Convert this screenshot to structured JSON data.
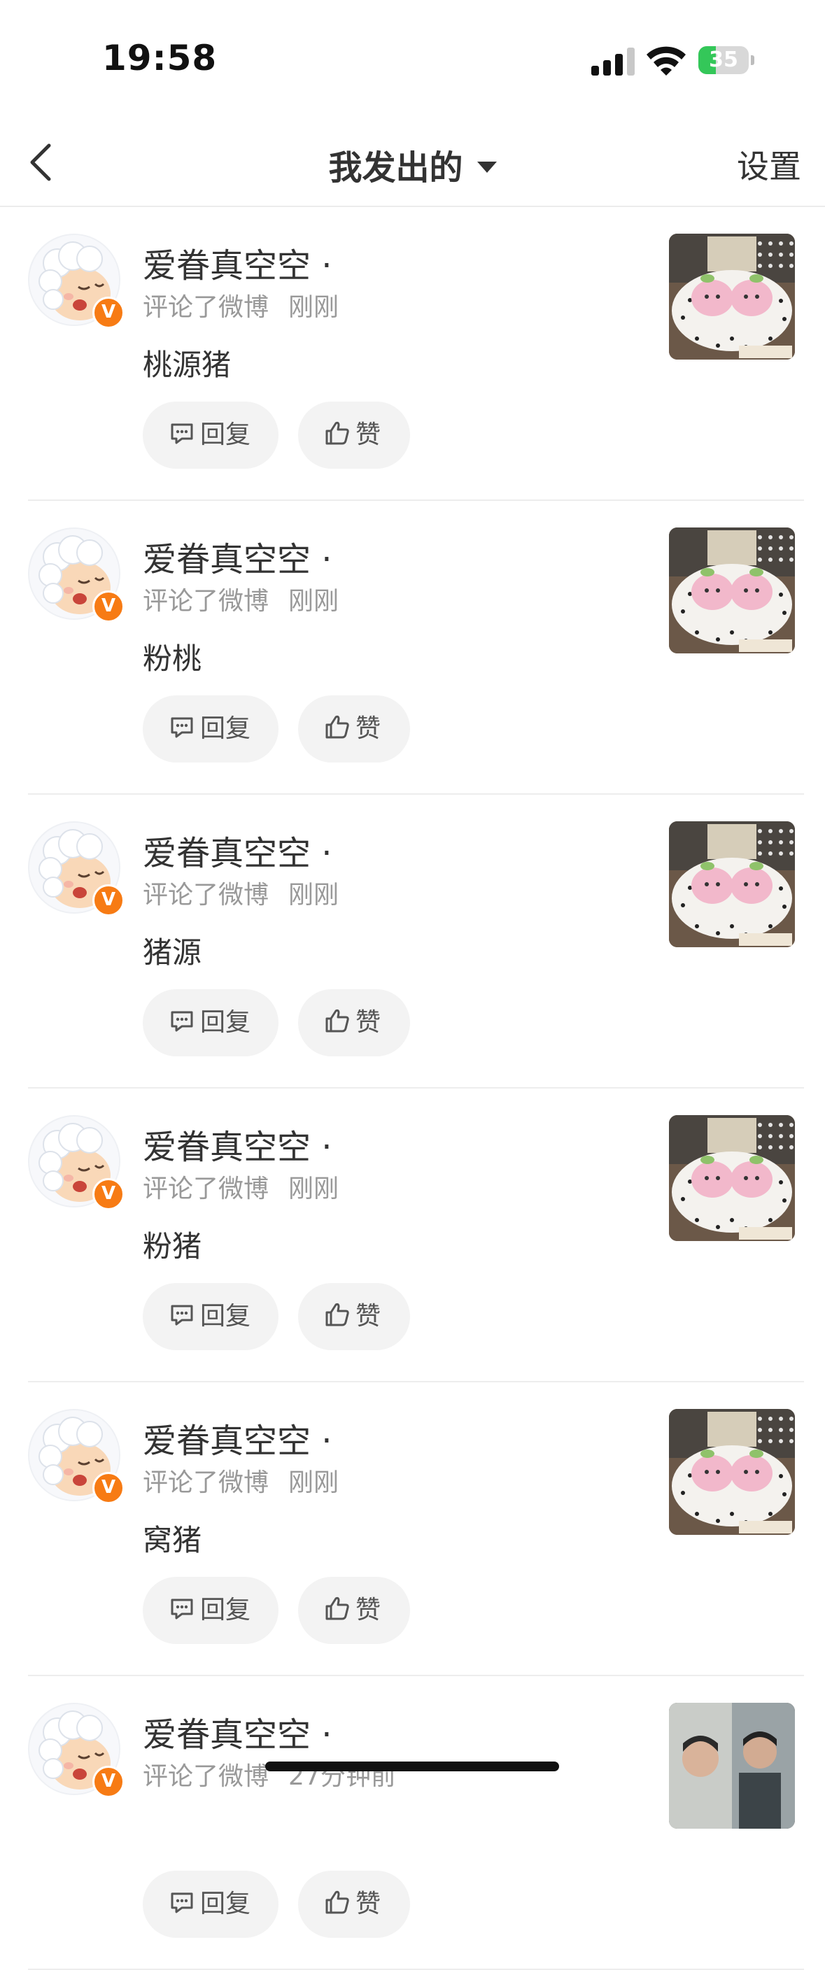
{
  "status_bar": {
    "time": "19:58",
    "battery_level": "35",
    "battery_fraction": 0.35,
    "icons": [
      "signal-icon",
      "wifi-icon",
      "battery-icon",
      "charging-bolt-icon"
    ]
  },
  "nav": {
    "back_icon": "chevron-left-icon",
    "title": "我发出的",
    "title_icon": "caret-down-icon",
    "settings_label": "设置"
  },
  "colors": {
    "accent_orange": "#f77b14",
    "meta_gray": "#999999",
    "button_bg": "#f3f3f3",
    "battery_green": "#34c759"
  },
  "comments": [
    {
      "username": "爱眷真空空",
      "dot": "·",
      "action": "评论了微博",
      "time": "刚刚",
      "text": "桃源猪",
      "reply_label": "回复",
      "like_label": "赞",
      "badge": "V",
      "thumb": "plush"
    },
    {
      "username": "爱眷真空空",
      "dot": "·",
      "action": "评论了微博",
      "time": "刚刚",
      "text": "粉桃",
      "reply_label": "回复",
      "like_label": "赞",
      "badge": "V",
      "thumb": "plush"
    },
    {
      "username": "爱眷真空空",
      "dot": "·",
      "action": "评论了微博",
      "time": "刚刚",
      "text": "猪源",
      "reply_label": "回复",
      "like_label": "赞",
      "badge": "V",
      "thumb": "plush"
    },
    {
      "username": "爱眷真空空",
      "dot": "·",
      "action": "评论了微博",
      "time": "刚刚",
      "text": "粉猪",
      "reply_label": "回复",
      "like_label": "赞",
      "badge": "V",
      "thumb": "plush"
    },
    {
      "username": "爱眷真空空",
      "dot": "·",
      "action": "评论了微博",
      "time": "刚刚",
      "text": "窝猪",
      "reply_label": "回复",
      "like_label": "赞",
      "badge": "V",
      "thumb": "plush"
    },
    {
      "username": "爱眷真空空",
      "dot": "·",
      "action": "评论了微博",
      "time": "27分钟前",
      "text": "",
      "reply_label": "回复",
      "like_label": "赞",
      "badge": "V",
      "thumb": "person"
    }
  ]
}
